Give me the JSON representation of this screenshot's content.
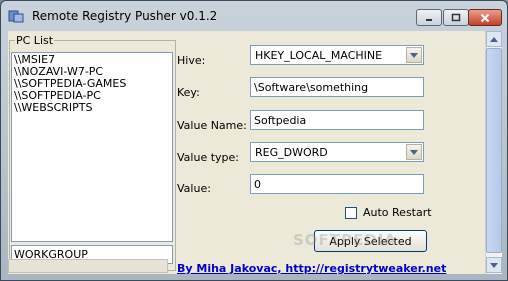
{
  "window": {
    "title": "Remote Registry Pusher v0.1.2",
    "icon": "registry-app-icon",
    "controls": [
      "minimize-icon",
      "maximize-icon",
      "close-icon"
    ]
  },
  "pc_list": {
    "label": "PC List",
    "items": [
      "\\\\MSIE7",
      "\\\\NOZAVI-W7-PC",
      "\\\\SOFTPEDIA-GAMES",
      "\\\\SOFTPEDIA-PC",
      "\\\\WEBSCRIPTS"
    ],
    "workgroup_value": "WORKGROUP"
  },
  "form": {
    "hive_label": "Hive:",
    "hive_value": "HKEY_LOCAL_MACHINE",
    "key_label": "Key:",
    "key_value": "\\Software\\something",
    "value_name_label": "Value Name:",
    "value_name_value": "Softpedia",
    "value_type_label": "Value type:",
    "value_type_value": "REG_DWORD",
    "value_label": "Value:",
    "value_value": "0",
    "auto_restart_label": "Auto Restart",
    "auto_restart_checked": false,
    "apply_button": "Apply Selected"
  },
  "footer": {
    "link_text": "By Miha Jakovac, http://registrytweaker.net"
  },
  "watermark": "SOFTPEDIA"
}
